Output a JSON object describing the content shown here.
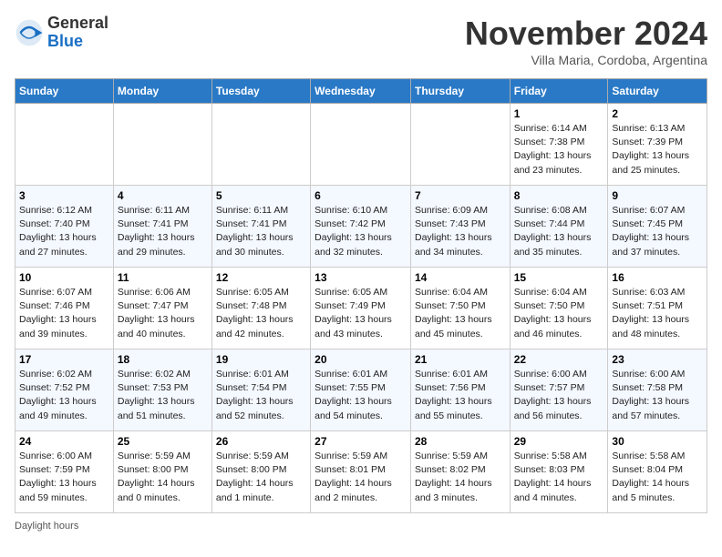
{
  "header": {
    "logo_general": "General",
    "logo_blue": "Blue",
    "month_title": "November 2024",
    "location": "Villa Maria, Cordoba, Argentina"
  },
  "days_of_week": [
    "Sunday",
    "Monday",
    "Tuesday",
    "Wednesday",
    "Thursday",
    "Friday",
    "Saturday"
  ],
  "weeks": [
    [
      {
        "day": "",
        "info": ""
      },
      {
        "day": "",
        "info": ""
      },
      {
        "day": "",
        "info": ""
      },
      {
        "day": "",
        "info": ""
      },
      {
        "day": "",
        "info": ""
      },
      {
        "day": "1",
        "info": "Sunrise: 6:14 AM\nSunset: 7:38 PM\nDaylight: 13 hours\nand 23 minutes."
      },
      {
        "day": "2",
        "info": "Sunrise: 6:13 AM\nSunset: 7:39 PM\nDaylight: 13 hours\nand 25 minutes."
      }
    ],
    [
      {
        "day": "3",
        "info": "Sunrise: 6:12 AM\nSunset: 7:40 PM\nDaylight: 13 hours\nand 27 minutes."
      },
      {
        "day": "4",
        "info": "Sunrise: 6:11 AM\nSunset: 7:41 PM\nDaylight: 13 hours\nand 29 minutes."
      },
      {
        "day": "5",
        "info": "Sunrise: 6:11 AM\nSunset: 7:41 PM\nDaylight: 13 hours\nand 30 minutes."
      },
      {
        "day": "6",
        "info": "Sunrise: 6:10 AM\nSunset: 7:42 PM\nDaylight: 13 hours\nand 32 minutes."
      },
      {
        "day": "7",
        "info": "Sunrise: 6:09 AM\nSunset: 7:43 PM\nDaylight: 13 hours\nand 34 minutes."
      },
      {
        "day": "8",
        "info": "Sunrise: 6:08 AM\nSunset: 7:44 PM\nDaylight: 13 hours\nand 35 minutes."
      },
      {
        "day": "9",
        "info": "Sunrise: 6:07 AM\nSunset: 7:45 PM\nDaylight: 13 hours\nand 37 minutes."
      }
    ],
    [
      {
        "day": "10",
        "info": "Sunrise: 6:07 AM\nSunset: 7:46 PM\nDaylight: 13 hours\nand 39 minutes."
      },
      {
        "day": "11",
        "info": "Sunrise: 6:06 AM\nSunset: 7:47 PM\nDaylight: 13 hours\nand 40 minutes."
      },
      {
        "day": "12",
        "info": "Sunrise: 6:05 AM\nSunset: 7:48 PM\nDaylight: 13 hours\nand 42 minutes."
      },
      {
        "day": "13",
        "info": "Sunrise: 6:05 AM\nSunset: 7:49 PM\nDaylight: 13 hours\nand 43 minutes."
      },
      {
        "day": "14",
        "info": "Sunrise: 6:04 AM\nSunset: 7:50 PM\nDaylight: 13 hours\nand 45 minutes."
      },
      {
        "day": "15",
        "info": "Sunrise: 6:04 AM\nSunset: 7:50 PM\nDaylight: 13 hours\nand 46 minutes."
      },
      {
        "day": "16",
        "info": "Sunrise: 6:03 AM\nSunset: 7:51 PM\nDaylight: 13 hours\nand 48 minutes."
      }
    ],
    [
      {
        "day": "17",
        "info": "Sunrise: 6:02 AM\nSunset: 7:52 PM\nDaylight: 13 hours\nand 49 minutes."
      },
      {
        "day": "18",
        "info": "Sunrise: 6:02 AM\nSunset: 7:53 PM\nDaylight: 13 hours\nand 51 minutes."
      },
      {
        "day": "19",
        "info": "Sunrise: 6:01 AM\nSunset: 7:54 PM\nDaylight: 13 hours\nand 52 minutes."
      },
      {
        "day": "20",
        "info": "Sunrise: 6:01 AM\nSunset: 7:55 PM\nDaylight: 13 hours\nand 54 minutes."
      },
      {
        "day": "21",
        "info": "Sunrise: 6:01 AM\nSunset: 7:56 PM\nDaylight: 13 hours\nand 55 minutes."
      },
      {
        "day": "22",
        "info": "Sunrise: 6:00 AM\nSunset: 7:57 PM\nDaylight: 13 hours\nand 56 minutes."
      },
      {
        "day": "23",
        "info": "Sunrise: 6:00 AM\nSunset: 7:58 PM\nDaylight: 13 hours\nand 57 minutes."
      }
    ],
    [
      {
        "day": "24",
        "info": "Sunrise: 6:00 AM\nSunset: 7:59 PM\nDaylight: 13 hours\nand 59 minutes."
      },
      {
        "day": "25",
        "info": "Sunrise: 5:59 AM\nSunset: 8:00 PM\nDaylight: 14 hours\nand 0 minutes."
      },
      {
        "day": "26",
        "info": "Sunrise: 5:59 AM\nSunset: 8:00 PM\nDaylight: 14 hours\nand 1 minute."
      },
      {
        "day": "27",
        "info": "Sunrise: 5:59 AM\nSunset: 8:01 PM\nDaylight: 14 hours\nand 2 minutes."
      },
      {
        "day": "28",
        "info": "Sunrise: 5:59 AM\nSunset: 8:02 PM\nDaylight: 14 hours\nand 3 minutes."
      },
      {
        "day": "29",
        "info": "Sunrise: 5:58 AM\nSunset: 8:03 PM\nDaylight: 14 hours\nand 4 minutes."
      },
      {
        "day": "30",
        "info": "Sunrise: 5:58 AM\nSunset: 8:04 PM\nDaylight: 14 hours\nand 5 minutes."
      }
    ]
  ],
  "footer": {
    "daylight_hours": "Daylight hours"
  }
}
